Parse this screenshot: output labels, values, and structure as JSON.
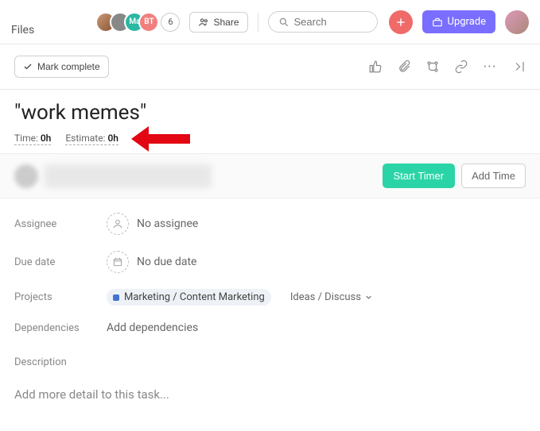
{
  "topbar": {
    "files": "Files",
    "avatars": {
      "a3": "Ma",
      "a4": "BT",
      "more_count": "6"
    },
    "share": "Share",
    "search_placeholder": "Search",
    "upgrade": "Upgrade"
  },
  "toolbar": {
    "mark_complete": "Mark complete"
  },
  "task": {
    "title": "\"work memes\"",
    "time_label": "Time: ",
    "time_value": "0h",
    "estimate_label": "Estimate: ",
    "estimate_value": "0h"
  },
  "timer": {
    "start": "Start Timer",
    "add_time": "Add Time"
  },
  "fields": {
    "assignee_label": "Assignee",
    "assignee_value": "No assignee",
    "due_label": "Due date",
    "due_value": "No due date",
    "projects_label": "Projects",
    "project_name": "Marketing / Content Marketing",
    "project_status": "Ideas / Discuss",
    "deps_label": "Dependencies",
    "deps_value": "Add dependencies",
    "desc_label": "Description",
    "desc_placeholder": "Add more detail to this task..."
  }
}
